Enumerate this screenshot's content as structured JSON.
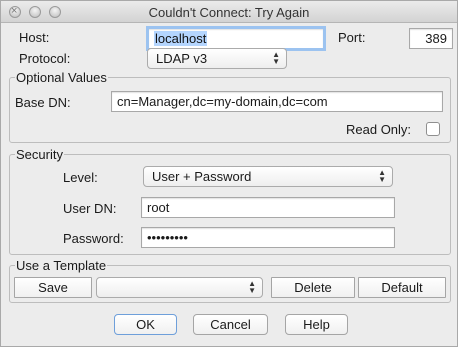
{
  "window": {
    "title": "Couldn't Connect: Try Again",
    "close_glyph": "×"
  },
  "connection": {
    "host_label": "Host:",
    "host_value": "localhost",
    "port_label": "Port:",
    "port_value": "389",
    "protocol_label": "Protocol:",
    "protocol_value": "LDAP v3"
  },
  "optional": {
    "title": "Optional Values",
    "base_dn_label": "Base DN:",
    "base_dn_value": "cn=Manager,dc=my-domain,dc=com",
    "read_only_label": "Read Only:",
    "read_only_checked": false
  },
  "security": {
    "title": "Security",
    "level_label": "Level:",
    "level_value": "User + Password",
    "user_dn_label": "User DN:",
    "user_dn_value": "root",
    "password_label": "Password:",
    "password_value": "•••••••••"
  },
  "template": {
    "title": "Use a Template",
    "save_label": "Save",
    "template_value": "",
    "delete_label": "Delete",
    "default_label": "Default"
  },
  "actions": {
    "ok_label": "OK",
    "cancel_label": "Cancel",
    "help_label": "Help"
  },
  "icons": {
    "popup_arrows": "▲▼"
  },
  "colors": {
    "selection": "#b4d5fe",
    "focus_ring": "#9cc3f0",
    "default_button_border": "#6e9fda"
  }
}
